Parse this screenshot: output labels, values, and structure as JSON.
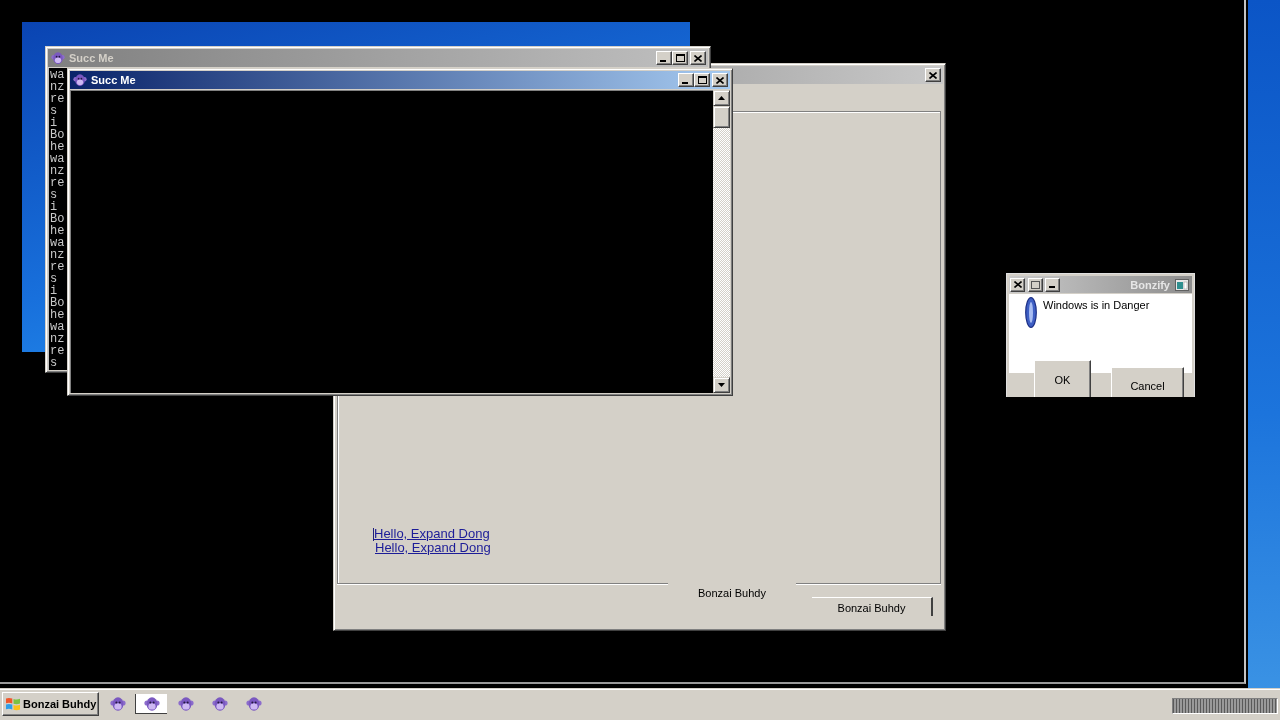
{
  "back_window": {
    "title": "Succ Me",
    "active": false,
    "output_lines": [
      "wa",
      "nz",
      "re",
      "s",
      "i",
      "Bo",
      "he",
      "wa",
      "nz",
      "re",
      "s",
      "i",
      "Bo",
      "he",
      "wa",
      "nz",
      "re",
      "s",
      "i",
      "Bo",
      "he",
      "wa",
      "nz",
      "re",
      "s"
    ]
  },
  "front_window": {
    "title": "Succ Me",
    "active": true
  },
  "main_window": {
    "links": [
      "Hello, Expand Dong",
      "Hello, Expand Dong"
    ],
    "group_label": "Bonzai Buhdy",
    "status_panel": "Bonzai Buhdy"
  },
  "dialog": {
    "title": "Bonzify",
    "message": "Windows is in Danger",
    "buttons": [
      {
        "label": "OK"
      },
      {
        "label": "Cancel"
      }
    ]
  },
  "taskbar": {
    "start_label": "Bonzai Buhdy",
    "buttons": [
      {
        "selected": false
      },
      {
        "selected": true
      },
      {
        "selected": false
      },
      {
        "selected": false
      },
      {
        "selected": false
      }
    ]
  }
}
